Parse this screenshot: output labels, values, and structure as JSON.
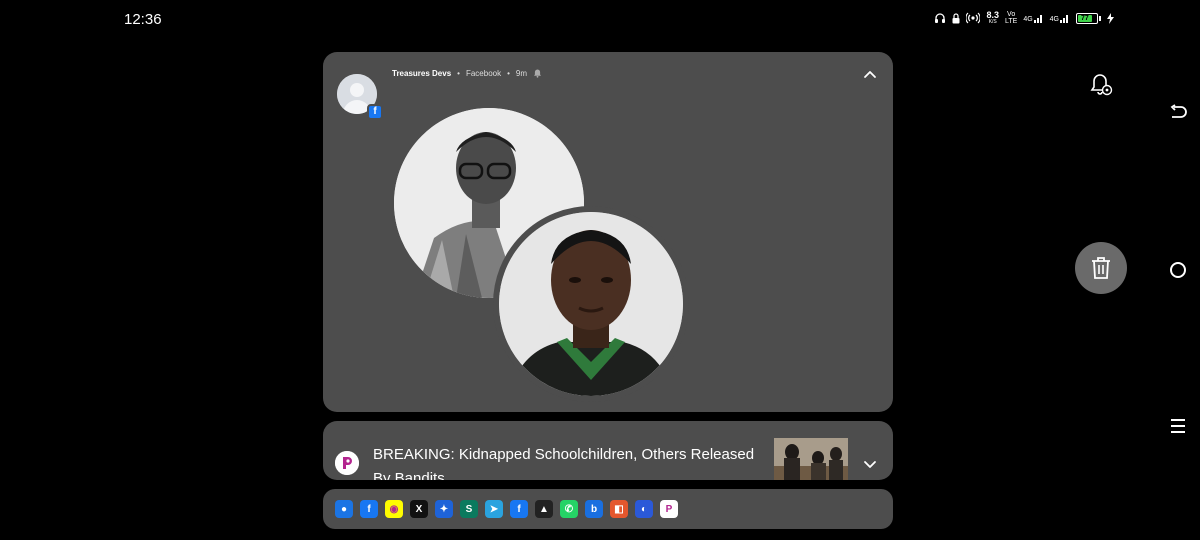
{
  "status_bar": {
    "time": "12:36",
    "net_speed_value": "8.3",
    "net_speed_unit": "K/S",
    "sim1_label_top": "Vo",
    "sim1_label_bottom": "LTE",
    "network_1": "4G",
    "network_2": "4G",
    "battery_level": "77",
    "battery_color": "#3fd24a"
  },
  "notification": {
    "sender": "Treasures Devs",
    "source": "Facebook",
    "time_ago": "9m",
    "badge_icon": "facebook-icon"
  },
  "news_notification": {
    "headline": "BREAKING: Kidnapped Schoolchildren, Others Released By Bandits",
    "app_icon": "pulse-app-icon"
  },
  "tray": {
    "apps": [
      {
        "name": "messenger-icon",
        "color": "#1b74e4",
        "glyph": "●"
      },
      {
        "name": "facebook-icon",
        "color": "#1877f2",
        "glyph": "f"
      },
      {
        "name": "snapchat-icon",
        "color": "#fffc00",
        "glyph": "◉"
      },
      {
        "name": "x-icon",
        "color": "#111111",
        "glyph": "X"
      },
      {
        "name": "app-icon-5",
        "color": "#1e63d9",
        "glyph": "✦"
      },
      {
        "name": "app-icon-6",
        "color": "#0b7a5e",
        "glyph": "S"
      },
      {
        "name": "telegram-icon",
        "color": "#2aa3df",
        "glyph": "➤"
      },
      {
        "name": "facebook-icon-2",
        "color": "#1877f2",
        "glyph": "f"
      },
      {
        "name": "app-icon-9",
        "color": "#222222",
        "glyph": "▲"
      },
      {
        "name": "whatsapp-icon",
        "color": "#25d366",
        "glyph": "✆"
      },
      {
        "name": "app-icon-11",
        "color": "#1a6fe0",
        "glyph": "b"
      },
      {
        "name": "office-icon",
        "color": "#e4572e",
        "glyph": "◧"
      },
      {
        "name": "app-icon-13",
        "color": "#2b59d8",
        "glyph": "◐"
      },
      {
        "name": "pulse-app-icon",
        "color": "#ffffff",
        "glyph": "P"
      }
    ]
  }
}
